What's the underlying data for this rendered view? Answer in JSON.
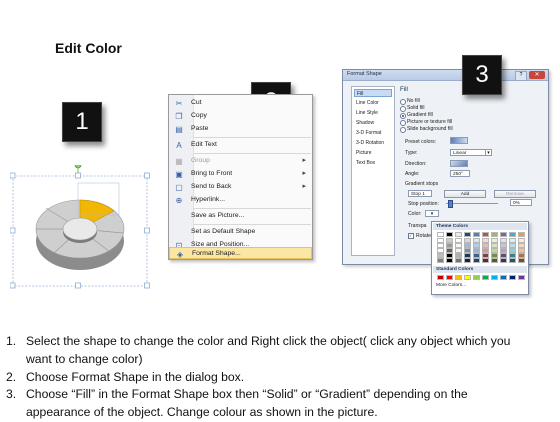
{
  "title": "Edit Color",
  "callouts": [
    "1",
    "2",
    "3"
  ],
  "context_menu": {
    "items": [
      {
        "label": "Cut",
        "icon": "scissors-icon",
        "disabled": false,
        "submenu": false
      },
      {
        "label": "Copy",
        "icon": "copy-icon",
        "disabled": false,
        "submenu": false
      },
      {
        "label": "Paste",
        "icon": "paste-icon",
        "disabled": false,
        "submenu": false
      },
      {
        "label": "Edit Text",
        "icon": "edit-text-icon",
        "disabled": false,
        "submenu": false
      },
      {
        "label": "Group",
        "icon": "group-icon",
        "disabled": true,
        "submenu": true
      },
      {
        "label": "Bring to Front",
        "icon": "bring-front-icon",
        "disabled": false,
        "submenu": true
      },
      {
        "label": "Send to Back",
        "icon": "send-back-icon",
        "disabled": false,
        "submenu": true
      },
      {
        "label": "Hyperlink...",
        "icon": "hyperlink-icon",
        "disabled": false,
        "submenu": false
      },
      {
        "label": "Save as Picture...",
        "icon": "",
        "disabled": false,
        "submenu": false
      },
      {
        "label": "Set as Default Shape",
        "icon": "",
        "disabled": false,
        "submenu": false
      },
      {
        "label": "Size and Position...",
        "icon": "size-icon",
        "disabled": false,
        "submenu": false
      },
      {
        "label": "Format Shape...",
        "icon": "format-shape-icon",
        "disabled": false,
        "submenu": false,
        "selected": true
      }
    ]
  },
  "dialog": {
    "title": "Format Shape",
    "nav": [
      "Fill",
      "Line Color",
      "Line Style",
      "Shadow",
      "3-D Format",
      "3-D Rotation",
      "Picture",
      "Text Box"
    ],
    "fill_heading": "Fill",
    "options": [
      "No fill",
      "Solid fill",
      "Gradient fill",
      "Picture or texture fill",
      "Slide background fill"
    ],
    "preset_label": "Preset colors:",
    "type_label": "Type:",
    "type_value": "Linear",
    "direction_label": "Direction:",
    "angle_label": "Angle:",
    "angle_value": "250°",
    "gradient_stops_label": "Gradient stops",
    "stop_value": "Stop 1",
    "add_label": "Add",
    "remove_label": "Remove",
    "stop_position_label": "Stop position:",
    "stop_position_value": "0%",
    "color_label": "Color:",
    "transparency_label": "Transpa",
    "rotate_label": "Rotate"
  },
  "palette": {
    "theme_header": "Theme Colors",
    "standard_header": "Standard Colors",
    "more_label": "More Colors...",
    "theme_top": [
      "#ffffff",
      "#000000",
      "#eeece1",
      "#1f497d",
      "#4f81bd",
      "#c0504d",
      "#9bbb59",
      "#8064a2",
      "#4bacc6",
      "#f79646"
    ],
    "standard": [
      "#c00000",
      "#ff0000",
      "#ffc000",
      "#ffff00",
      "#92d050",
      "#00b050",
      "#00b0f0",
      "#0070c0",
      "#002060",
      "#7030a0"
    ]
  },
  "shape": {
    "highlight_color": "#f2b705",
    "base_color": "#b8b8b8"
  },
  "steps": [
    {
      "num": "1.",
      "lines": [
        "Select the shape to change the color and Right click the object( click any object which you",
        "want to change color)"
      ]
    },
    {
      "num": "2.",
      "lines": [
        "Choose Format Shape in the dialog box."
      ]
    },
    {
      "num": "3.",
      "lines": [
        "Choose “Fill” in the Format Shape box then “Solid” or “Gradient” depending on the",
        "appearance of the object. Change colour as shown in the picture."
      ]
    }
  ]
}
